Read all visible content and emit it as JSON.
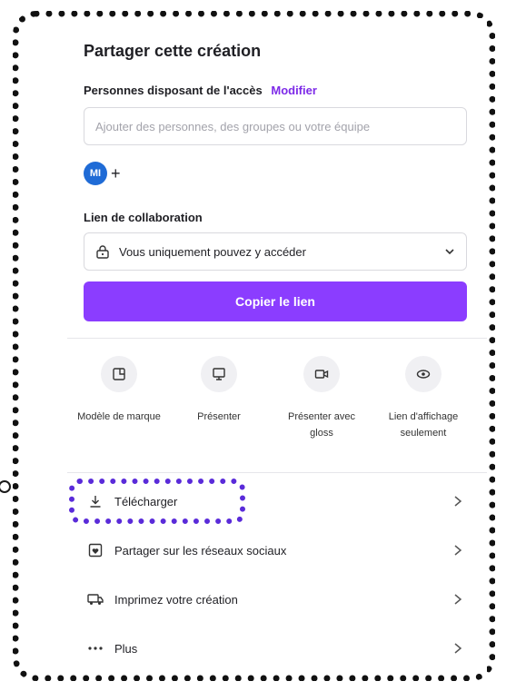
{
  "share": {
    "title": "Partager cette création",
    "access_label": "Personnes disposant de l'accès",
    "modify_link": "Modifier",
    "search_placeholder": "Ajouter des personnes, des groupes ou votre équipe",
    "avatar_initials": "MI",
    "add_symbol": "+",
    "collab_label": "Lien de collaboration",
    "access_option": "Vous uniquement pouvez y accéder",
    "copy_button": "Copier le lien"
  },
  "options": [
    {
      "label": "Modèle de marque",
      "icon": "brand-template-icon"
    },
    {
      "label": "Présenter",
      "icon": "present-icon"
    },
    {
      "label": "Présenter avec gloss",
      "icon": "present-record-icon"
    },
    {
      "label": "Lien d'affichage seulement",
      "icon": "view-link-icon"
    }
  ],
  "actions": [
    {
      "label": "Télécharger",
      "icon": "download-icon"
    },
    {
      "label": "Partager sur les réseaux sociaux",
      "icon": "social-share-icon"
    },
    {
      "label": "Imprimez votre création",
      "icon": "print-icon"
    },
    {
      "label": "Plus",
      "icon": "more-icon"
    }
  ],
  "colors": {
    "accent": "#8b3dff",
    "link": "#7d2ae8",
    "highlight": "#5a2bd9",
    "avatar": "#1f6bd6"
  }
}
